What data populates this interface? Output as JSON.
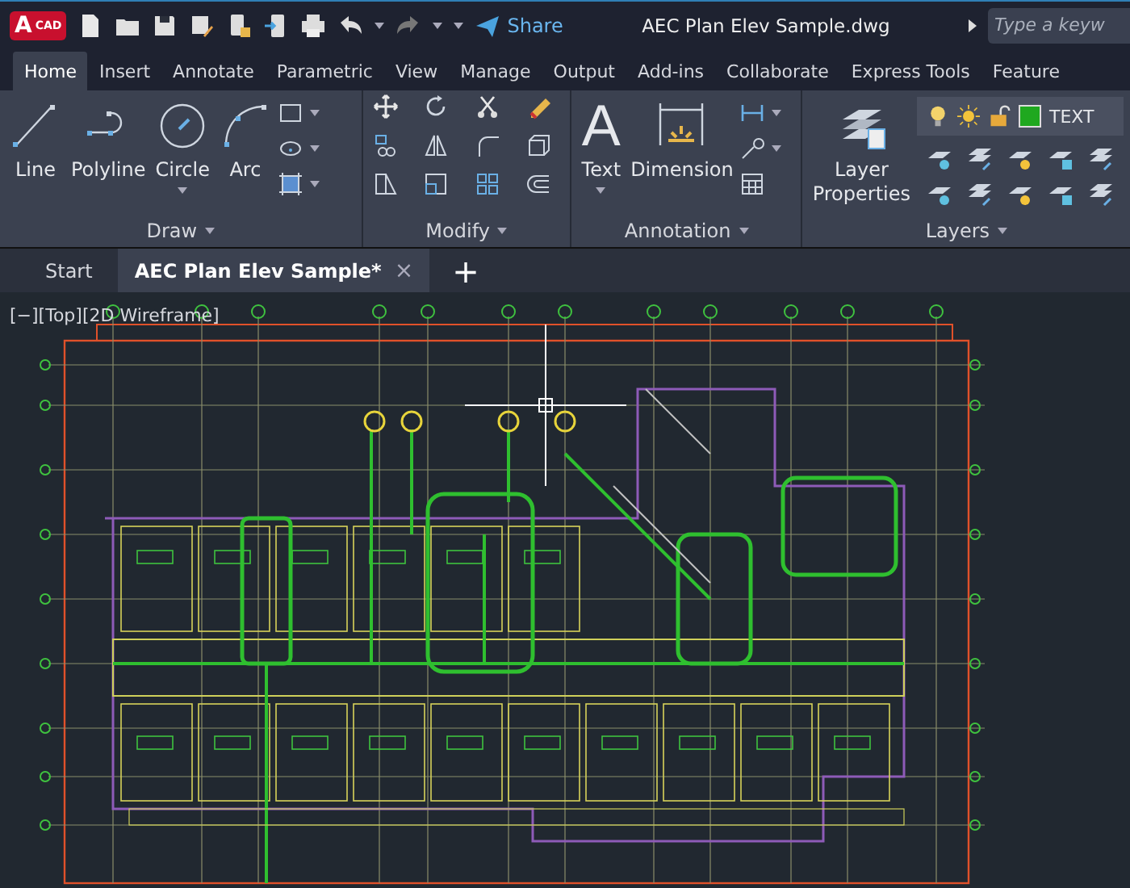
{
  "title_bar": {
    "logo": "A",
    "logo_suffix": "CAD",
    "share": "Share",
    "title": "AEC Plan Elev Sample.dwg",
    "search": {
      "placeholder": "Type a keyw"
    }
  },
  "ribbon_tabs": [
    {
      "label": "Home",
      "selected": true
    },
    {
      "label": "Insert",
      "selected": false
    },
    {
      "label": "Annotate",
      "selected": false
    },
    {
      "label": "Parametric",
      "selected": false
    },
    {
      "label": "View",
      "selected": false
    },
    {
      "label": "Manage",
      "selected": false
    },
    {
      "label": "Output",
      "selected": false
    },
    {
      "label": "Add-ins",
      "selected": false
    },
    {
      "label": "Collaborate",
      "selected": false
    },
    {
      "label": "Express Tools",
      "selected": false
    },
    {
      "label": "Feature",
      "selected": false
    }
  ],
  "panels": {
    "draw": {
      "title": "Draw",
      "tools": [
        "Line",
        "Polyline",
        "Circle",
        "Arc"
      ]
    },
    "modify": {
      "title": "Modify"
    },
    "annotation": {
      "title": "Annotation",
      "text_glyph": "A",
      "tools": [
        "Text",
        "Dimension"
      ]
    },
    "layers": {
      "title": "Layers",
      "tool": "Layer Properties",
      "current_layer": {
        "name": "TEXT",
        "color": "#1fa81f"
      }
    }
  },
  "document_tabs": [
    {
      "label": "Start",
      "selected": false
    },
    {
      "label": "AEC Plan Elev Sample*",
      "selected": true
    }
  ],
  "close_glyph": "×",
  "new_tab_glyph": "+",
  "viewport": {
    "label": "[−][Top][2D Wireframe]"
  }
}
